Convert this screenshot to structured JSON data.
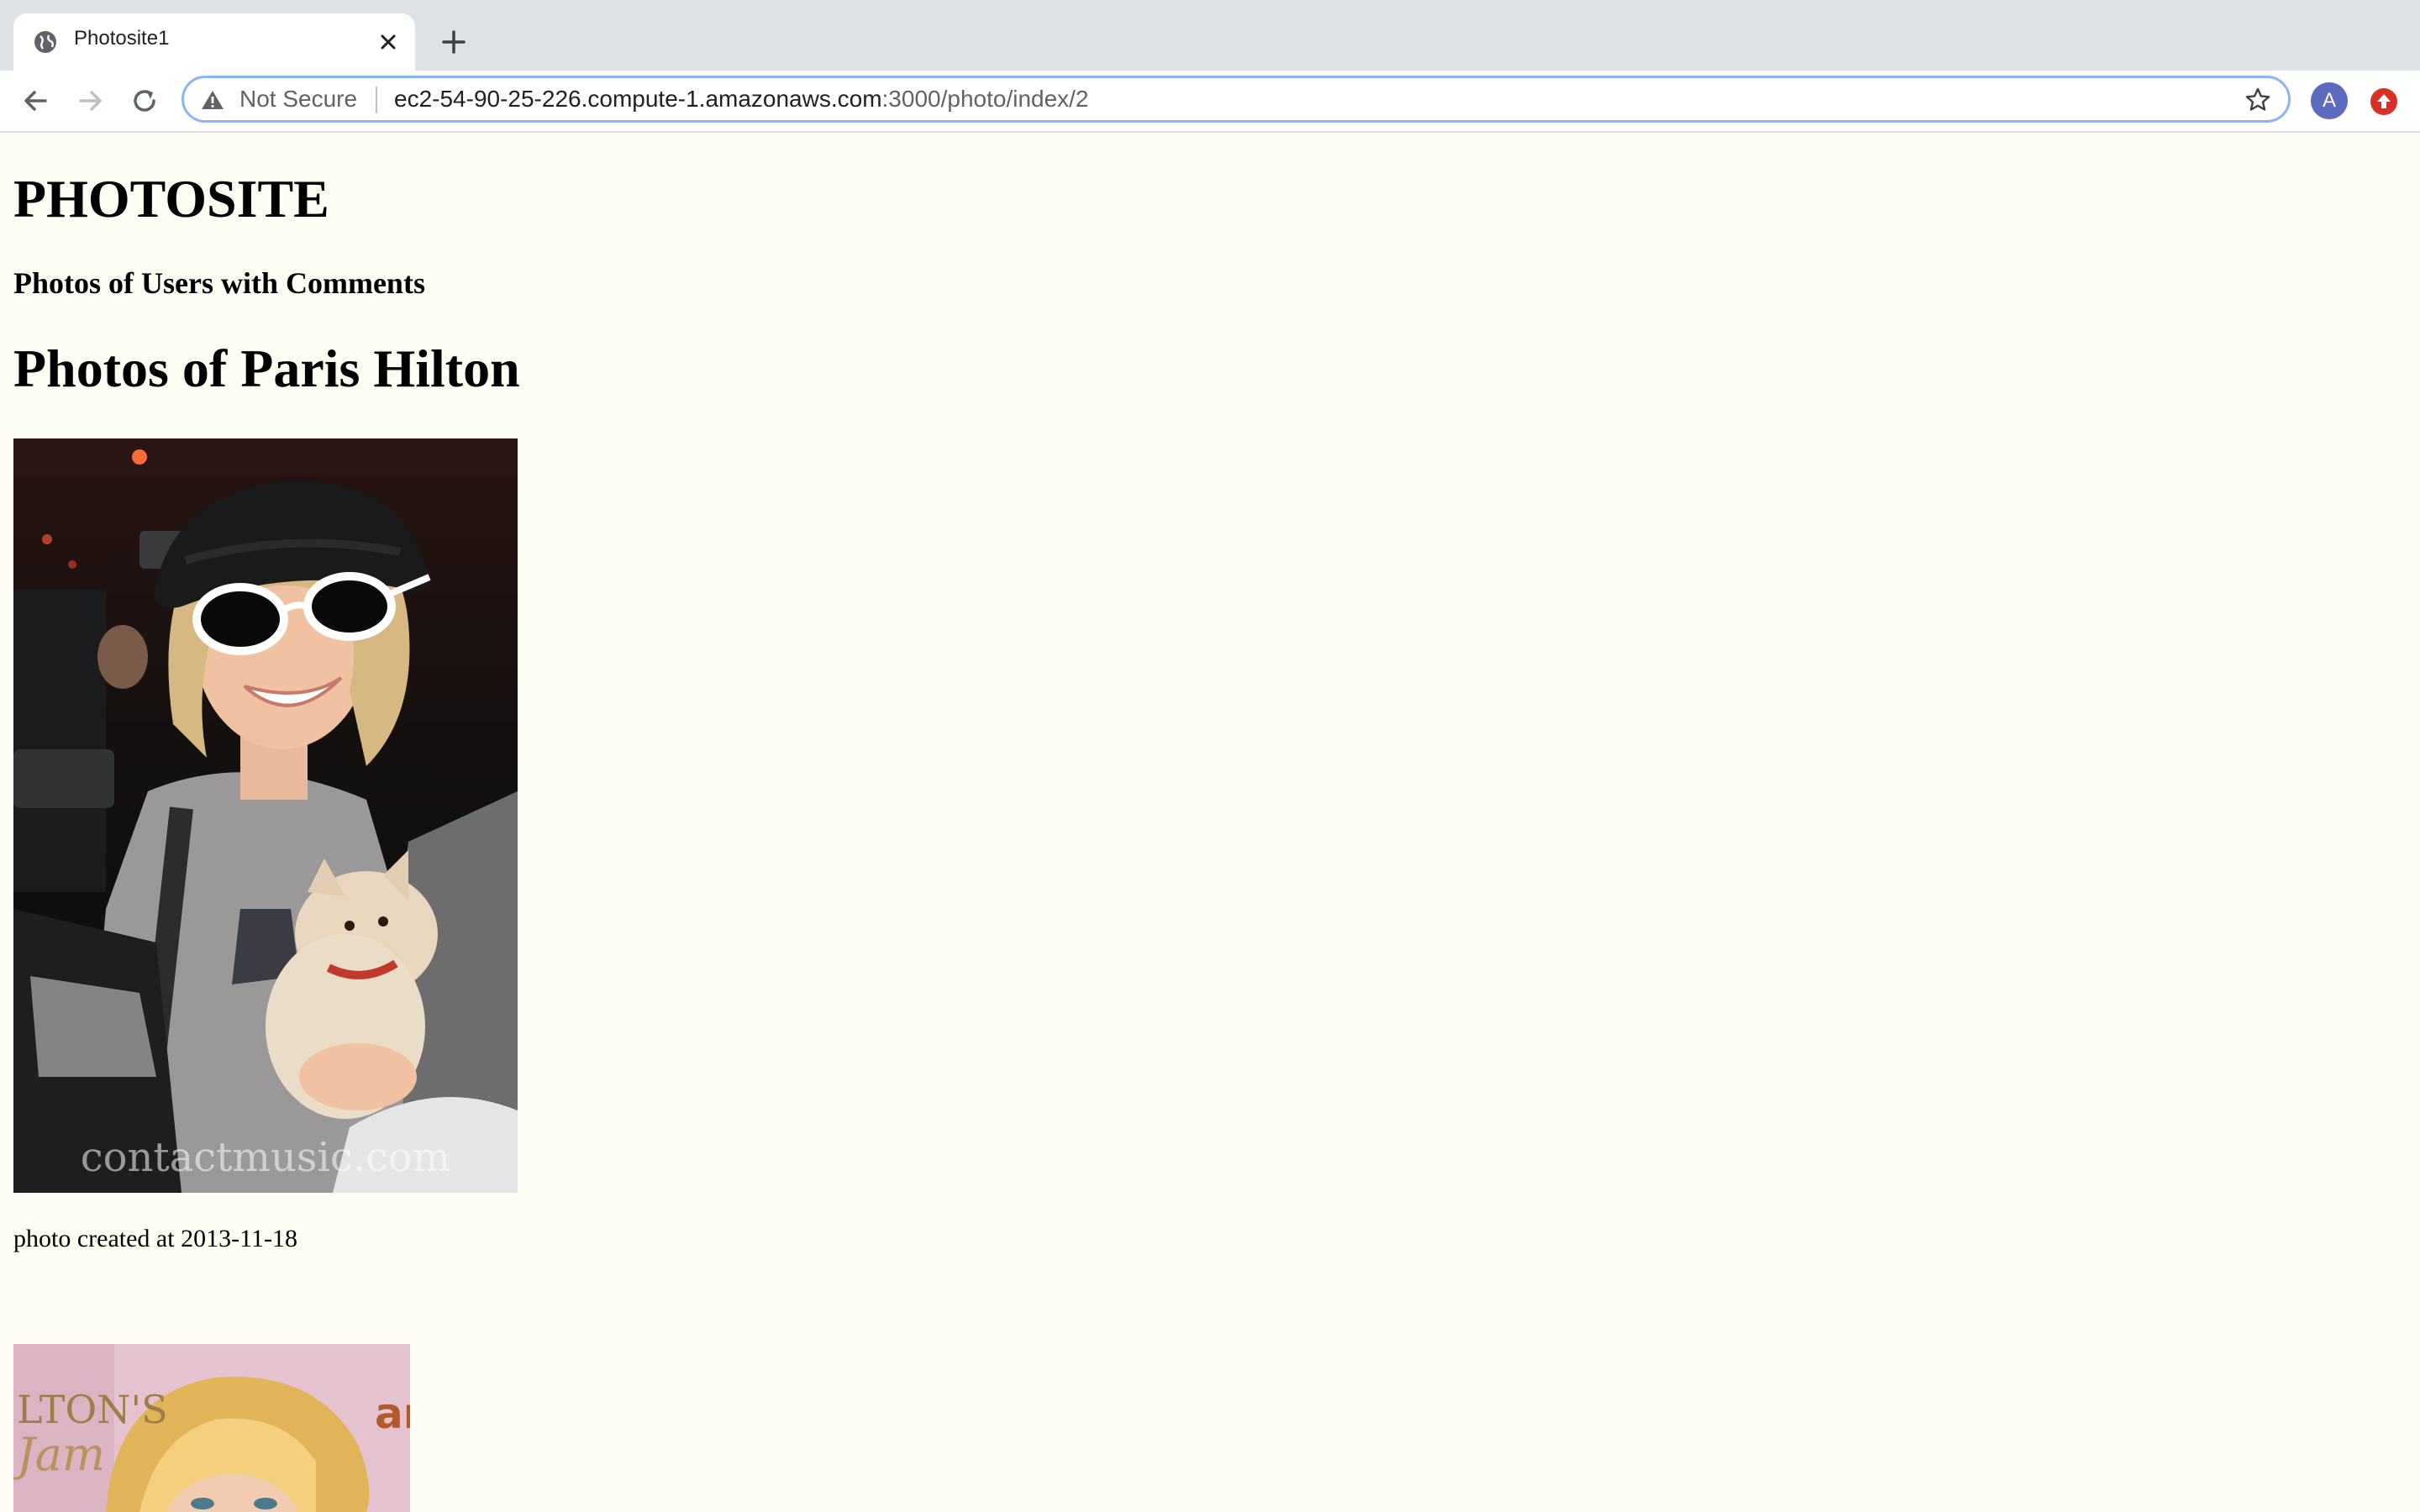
{
  "browser": {
    "tab_title": "Photosite1",
    "security_label": "Not Secure",
    "url_host": "ec2-54-90-25-226.compute-1.amazonaws.com",
    "url_path": ":3000/photo/index/2",
    "profile_initial": "A"
  },
  "page": {
    "site_title": "PHOTOSITE",
    "subtitle": "Photos of Users with Comments",
    "heading": "Photos of Paris Hilton"
  },
  "photos": [
    {
      "watermark": "contactmusic.com",
      "caption": "photo created at 2013-11-18"
    },
    {
      "visible_text": "LTON'S Jam ame"
    }
  ]
}
